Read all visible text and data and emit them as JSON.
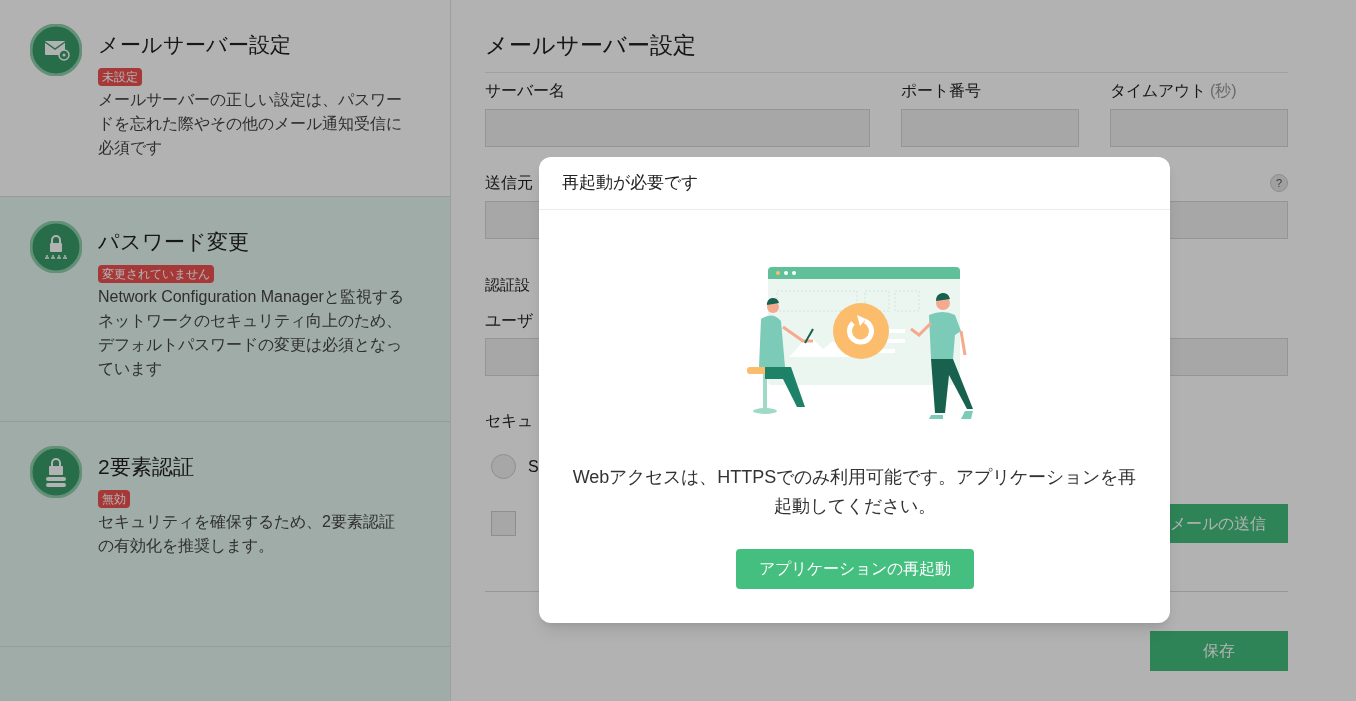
{
  "sidebar": {
    "items": [
      {
        "kind": "mail",
        "title": "メールサーバー設定",
        "badge": "未設定",
        "description": "メールサーバーの正しい設定は、パスワードを忘れた際やその他のメール通知受信に必須です",
        "selected": true
      },
      {
        "kind": "password",
        "title": "パスワード変更",
        "badge": "変更されていません",
        "description": "Network Configuration Managerと監視するネットワークのセキュリティ向上のため、デフォルトパスワードの変更は必須となっています",
        "selected": false
      },
      {
        "kind": "device",
        "title": "2要素認証",
        "badge": "無効",
        "description": "セキュリティを確保するため、2要素認証の有効化を推奨します。",
        "selected": false
      }
    ]
  },
  "form": {
    "title": "メールサーバー設定",
    "server_label": "サーバー名",
    "port_label": "ポート番号",
    "timeout_label": "タイムアウト",
    "timeout_hint": "(秒)",
    "sender_label": "送信元",
    "help": "?",
    "auth_label": "認証設",
    "user_label": "ユーザ",
    "security_label": "セキュ",
    "radio": {
      "label": "S",
      "selected": false
    },
    "checkbox": {
      "checked": false
    },
    "send_button": "メールの送信",
    "save_button": "保存"
  },
  "dialog": {
    "title": "再起動が必要です",
    "message": "Webアクセスは、HTTPSでのみ利用可能です。アプリケーションを再起動してください。",
    "button": "アプリケーションの再起動"
  }
}
